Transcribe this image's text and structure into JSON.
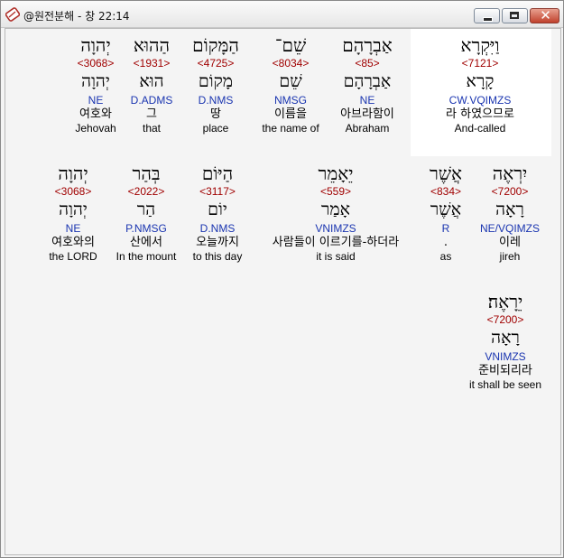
{
  "window": {
    "title": "@원전분해 - 창 22:14",
    "buttons": {
      "minimize": "minimize",
      "maximize": "maximize",
      "close": "✕"
    }
  },
  "rows": [
    {
      "words": [
        {
          "heb": "וַיִּקְרָא",
          "strong": "<7121>",
          "root": "קָרָא",
          "morph": "CW.VQIMZS",
          "korean": "라 하였으므로",
          "english": "And-called"
        },
        {
          "heb": "אַבְרָהָם",
          "strong": "<85>",
          "root": "אַבְרָהָם",
          "morph": "NE",
          "korean": "아브라함이",
          "english": "Abraham"
        },
        {
          "heb": "שֵׁם־",
          "strong": "<8034>",
          "root": "שֵׁם",
          "morph": "NMSG",
          "korean": "이름을",
          "english": "the name of"
        },
        {
          "heb": "הַמָּקוֹם",
          "strong": "<4725>",
          "root": "מָקוֹם",
          "morph": "D.NMS",
          "korean": "땅",
          "english": "place"
        },
        {
          "heb": "הַהוּא",
          "strong": "<1931>",
          "root": "הוּא",
          "morph": "D.ADMS",
          "korean": "그",
          "english": "that"
        },
        {
          "heb": "יְהוָה",
          "strong": "<3068>",
          "root": "יְהוָה",
          "morph": "NE",
          "korean": "여호와",
          "english": "Jehovah"
        }
      ]
    },
    {
      "words": [
        {
          "heb": "יִרְאֶה",
          "strong": "<7200>",
          "root": "רָאָה",
          "morph": "NE/VQIMZS",
          "korean": "이레",
          "english": "jireh"
        },
        {
          "heb": "אֲשֶׁר",
          "strong": "<834>",
          "root": "אֲשֶׁר",
          "morph": "R",
          "korean": ".",
          "english": "as"
        },
        {
          "heb": "יֵאָמֵר",
          "strong": "<559>",
          "root": "אָמַר",
          "morph": "VNIMZS",
          "korean": "사람들이 이르기를-하더라",
          "english": "it is said"
        },
        {
          "heb": "הַיּוֹם",
          "strong": "<3117>",
          "root": "יוֹם",
          "morph": "D.NMS",
          "korean": "오늘까지",
          "english": "to this day"
        },
        {
          "heb": "בְּהַר",
          "strong": "<2022>",
          "root": "הַר",
          "morph": "P.NMSG",
          "korean": "산에서",
          "english": "In the mount"
        },
        {
          "heb": "יְהוָה",
          "strong": "<3068>",
          "root": "יְהוָה",
          "morph": "NE",
          "korean": "여호와의",
          "english": "the LORD"
        }
      ]
    },
    {
      "words": [
        {
          "heb": "יֵרָאֶה׃",
          "strong": "<7200>",
          "root": "רָאָה",
          "morph": "VNIMZS",
          "korean": "준비되리라",
          "english": "it shall be seen"
        }
      ]
    }
  ]
}
